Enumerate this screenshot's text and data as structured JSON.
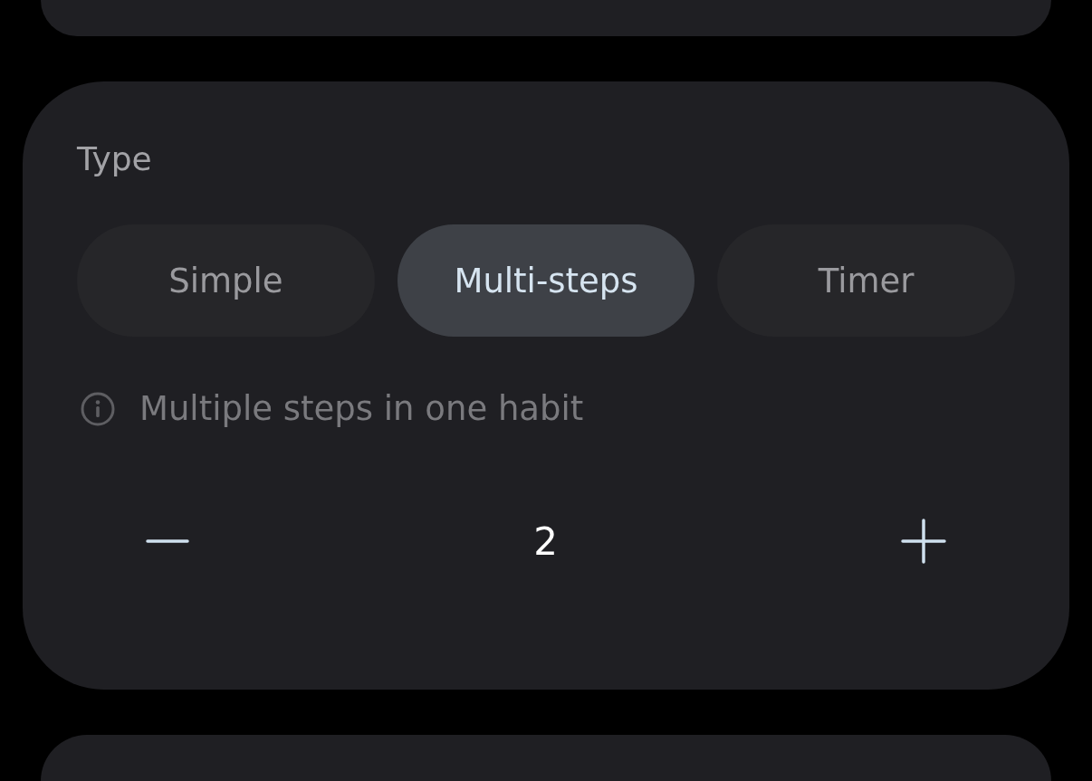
{
  "type_card": {
    "label": "Type",
    "options": [
      {
        "label": "Simple",
        "selected": false
      },
      {
        "label": "Multi-steps",
        "selected": true
      },
      {
        "label": "Timer",
        "selected": false
      }
    ],
    "hint": "Multiple steps in one habit",
    "stepper": {
      "value": "2"
    }
  }
}
